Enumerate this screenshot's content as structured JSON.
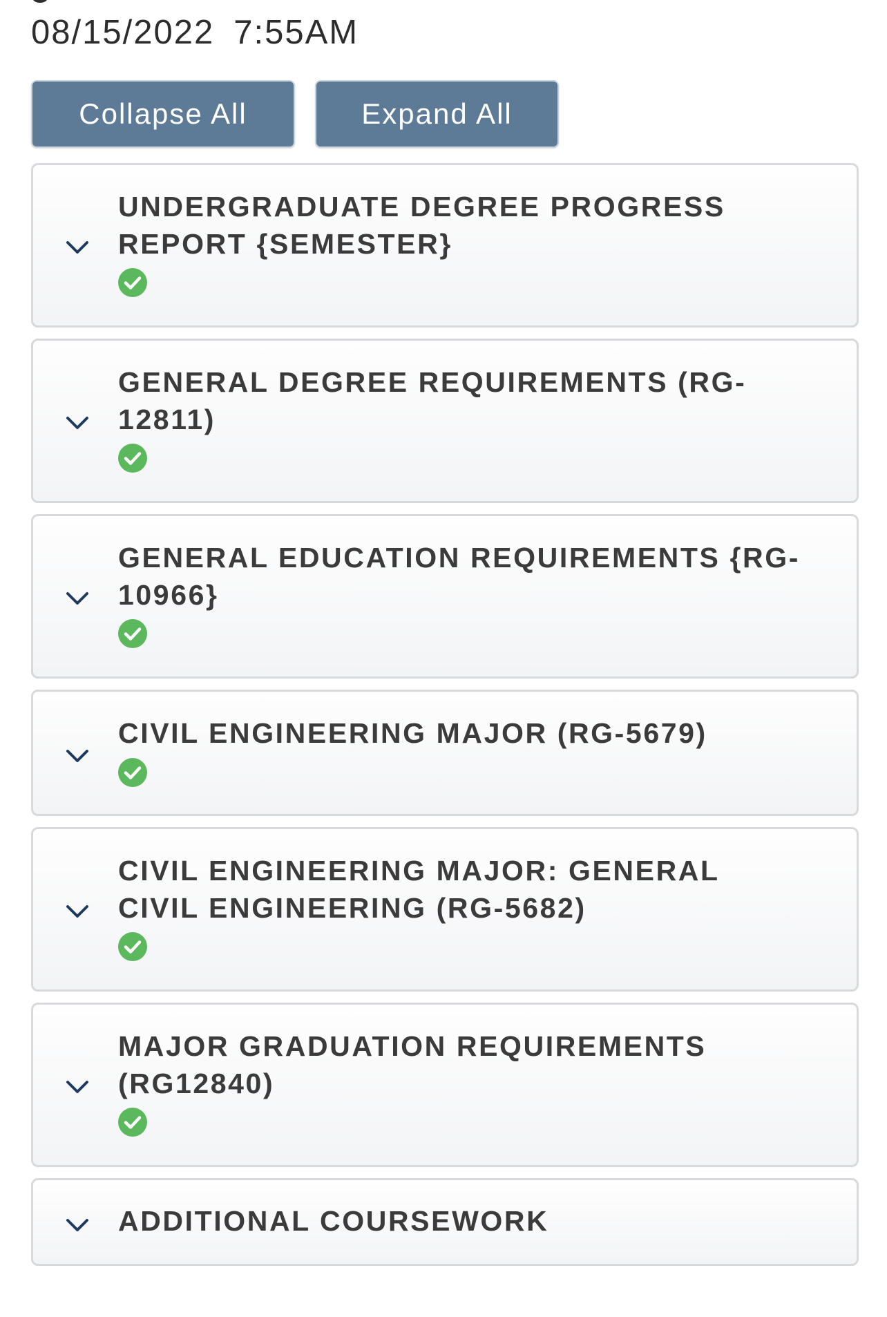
{
  "report": {
    "date": "08/15/2022",
    "time": "7:55AM"
  },
  "controls": {
    "collapse_all": "Collapse All",
    "expand_all": "Expand All"
  },
  "sections": [
    {
      "title": "UNDERGRADUATE DEGREE PROGRESS\nREPORT {SEMESTER}",
      "status": "complete",
      "expand_icon": "chevron-down-icon"
    },
    {
      "title": "GENERAL DEGREE REQUIREMENTS (RG-\n12811)",
      "status": "complete",
      "expand_icon": "chevron-down-icon"
    },
    {
      "title": "GENERAL EDUCATION REQUIREMENTS {RG-\n10966}",
      "status": "complete",
      "expand_icon": "chevron-down-icon"
    },
    {
      "title": "CIVIL ENGINEERING MAJOR (RG-5679)",
      "status": "complete",
      "expand_icon": "chevron-down-icon"
    },
    {
      "title": "CIVIL ENGINEERING MAJOR: GENERAL\nCIVIL ENGINEERING (RG-5682)",
      "status": "complete",
      "expand_icon": "chevron-down-icon"
    },
    {
      "title": "MAJOR GRADUATION REQUIREMENTS\n(RG12840)",
      "status": "complete",
      "expand_icon": "chevron-down-icon"
    },
    {
      "title": "ADDITIONAL COURSEWORK",
      "status": "none",
      "expand_icon": "chevron-down-icon"
    }
  ],
  "colors": {
    "button_bg": "#5d7a97",
    "chevron": "#1f3a5f",
    "check_green": "#5cb85c",
    "panel_border": "#d7d9dc"
  }
}
